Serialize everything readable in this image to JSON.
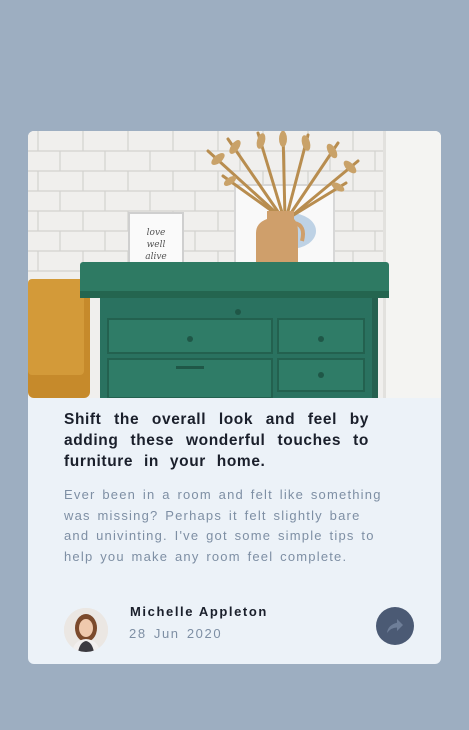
{
  "article": {
    "image_alt": "Green dresser with vase of dried grass against white brick wall",
    "title": "Shift the overall look and feel by adding these wonderful touches to furniture in your home.",
    "description": "Ever been in a room and felt like something was missing? Perhaps it felt slightly bare and univinting. I've got some simple tips to help you make any room feel complete."
  },
  "author": {
    "name": "Michelle Appleton",
    "date": "28 Jun 2020"
  },
  "actions": {
    "share_icon": "share-arrow-icon"
  },
  "colors": {
    "background": "#9daec1",
    "card": "#ecf2f8",
    "title": "#1a1f2b",
    "text_muted": "#7e8fa4",
    "share_button": "#4b5a74"
  }
}
